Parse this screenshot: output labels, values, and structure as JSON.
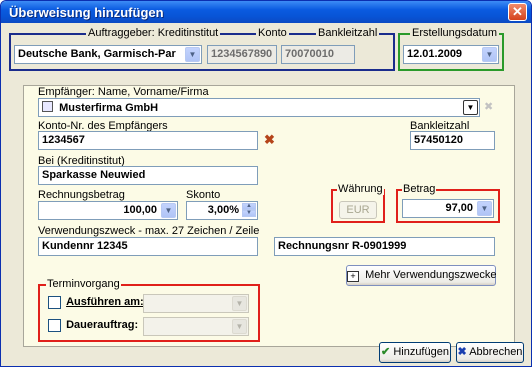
{
  "window": {
    "title": "Überweisung hinzufügen",
    "close_glyph": "✕"
  },
  "sender": {
    "group_label": "Auftraggeber: Kreditinstitut",
    "konto_label": "Konto",
    "blz_label": "Bankleitzahl",
    "bank": "Deutsche Bank, Garmisch-Par",
    "konto": "1234567890",
    "blz": "70070010"
  },
  "date": {
    "label": "Erstellungsdatum",
    "value": "12.01.2009"
  },
  "recipient": {
    "name_label": "Empfänger: Name, Vorname/Firma",
    "name": "Musterfirma GmbH",
    "konto_label": "Konto-Nr. des Empfängers",
    "konto": "1234567",
    "blz_label": "Bankleitzahl",
    "blz": "57450120",
    "bank_label": "Bei (Kreditinstitut)",
    "bank": "Sparkasse Neuwied"
  },
  "amounts": {
    "rechnungsbetrag_label": "Rechnungsbetrag",
    "rechnungsbetrag": "100,00",
    "skonto_label": "Skonto",
    "skonto": "3,00%",
    "waehrung_label": "Währung",
    "waehrung": "EUR",
    "betrag_label": "Betrag",
    "betrag": "97,00"
  },
  "purpose": {
    "label": "Verwendungszweck - max. 27 Zeichen / Zeile",
    "line1": "Kundennr 12345",
    "line2": "Rechnungsnr R-0901999",
    "more_button": "Mehr Verwendungszwecke"
  },
  "schedule": {
    "group_label": "Terminvorgang",
    "execute_label": "Ausführen am:",
    "standing_label": "Dauerauftrag:"
  },
  "buttons": {
    "add": "Hinzufügen",
    "cancel": "Abbrechen"
  },
  "colors": {
    "highlight_blue": "#1a2c8c",
    "highlight_green": "#2a9a2a",
    "highlight_red": "#e0201a",
    "title_blue": "#0a5be0"
  }
}
